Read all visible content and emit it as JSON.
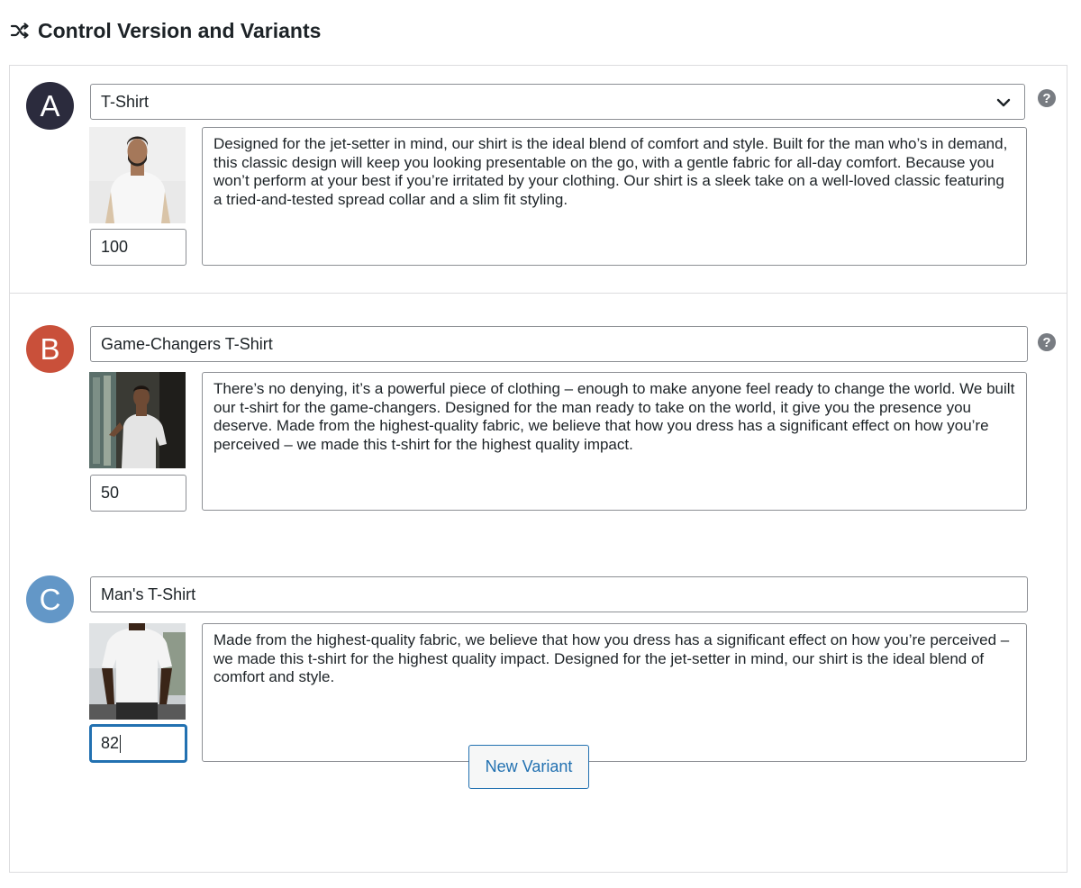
{
  "section": {
    "title": "Control Version and Variants",
    "icon": "shuffle-icon"
  },
  "variants": [
    {
      "letter": "A",
      "badge_color": "#2b2b3d",
      "name": "T-Shirt",
      "name_is_select": true,
      "weight": "100",
      "description": "Designed for the jet-setter in mind, our shirt is the ideal blend of comfort and style. Built for the man who’s in demand, this classic design will keep you looking presentable on the go, with a gentle fabric for all-day comfort. Because you won’t perform at your best if you’re irritated by your clothing. Our shirt is a sleek take on a well-loved classic featuring a tried-and-tested spread collar and a slim fit styling."
    },
    {
      "letter": "B",
      "badge_color": "#c9503a",
      "name": "Game-Changers T-Shirt",
      "name_is_select": false,
      "weight": "50",
      "description": "There’s no denying, it’s a powerful piece of clothing – enough to make anyone feel ready to change the world. We built our t-shirt for the game-changers. Designed for the man ready to take on the world, it give you the presence you deserve. Made from the highest-quality fabric, we believe that how you dress has a significant effect on how you’re perceived – we made this t-shirt for the highest quality impact."
    },
    {
      "letter": "C",
      "badge_color": "#6397c7",
      "name": "Man's T-Shirt",
      "name_is_select": false,
      "weight": "82",
      "description": "Made from the highest-quality fabric, we believe that how you dress has a significant effect on how you’re perceived – we made this t-shirt for the highest quality impact. Designed for the jet-setter in mind, our shirt is the ideal blend of comfort and style."
    }
  ],
  "help_glyph": "?",
  "new_variant_label": "New Variant",
  "colors": {
    "accent": "#2271b1",
    "border": "#8c8f94"
  }
}
